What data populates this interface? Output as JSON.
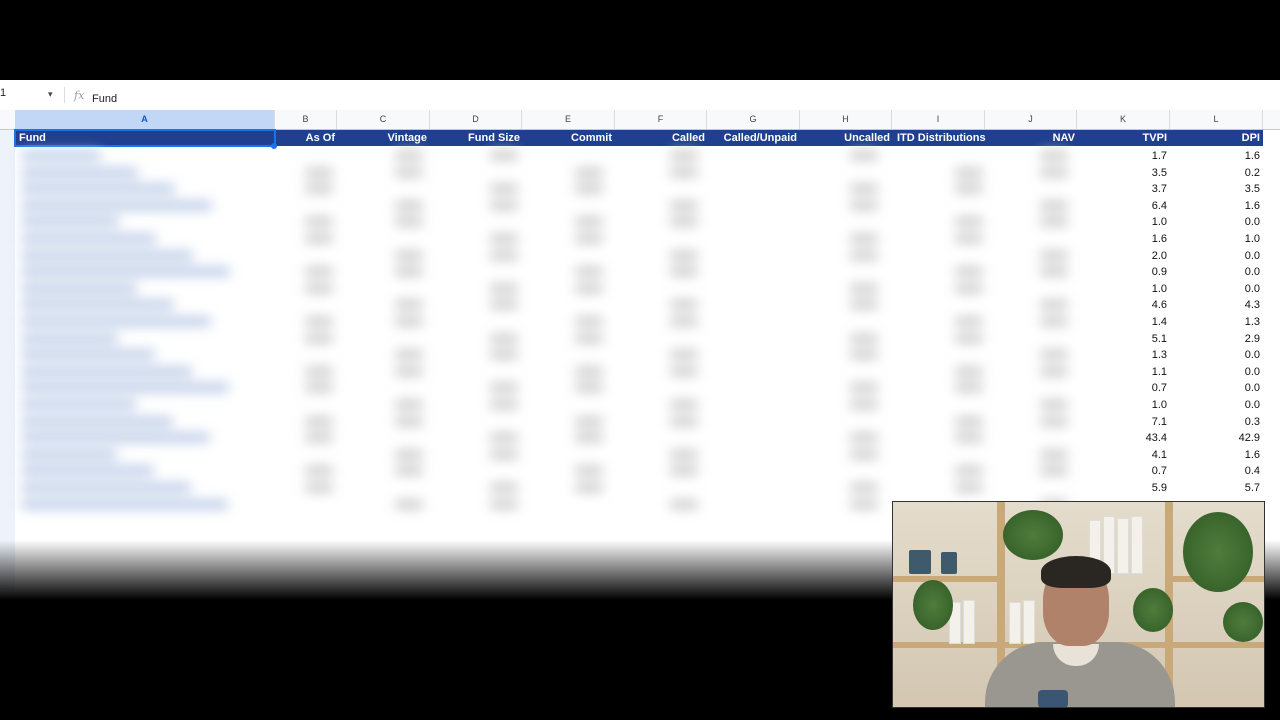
{
  "formula_bar": {
    "name_box": "1",
    "fx": "fx",
    "content": "Fund"
  },
  "column_letters": [
    "A",
    "B",
    "C",
    "D",
    "E",
    "F",
    "G",
    "H",
    "I",
    "J",
    "K",
    "L"
  ],
  "headers": {
    "fund": "Fund",
    "as_of": "As Of",
    "vintage": "Vintage",
    "fund_size": "Fund Size",
    "commit": "Commit",
    "called": "Called",
    "called_unpaid": "Called/Unpaid",
    "uncalled": "Uncalled",
    "itd_distributions": "ITD Distributions",
    "nav": "NAV",
    "tvpi": "TVPI",
    "dpi": "DPI"
  },
  "tvpi": [
    "1.7",
    "3.5",
    "3.7",
    "6.4",
    "1.0",
    "1.6",
    "2.0",
    "0.9",
    "1.0",
    "4.6",
    "1.4",
    "5.1",
    "1.3",
    "1.1",
    "0.7",
    "1.0",
    "7.1",
    "43.4",
    "4.1",
    "0.7",
    "5.9"
  ],
  "dpi": [
    "1.6",
    "0.2",
    "3.5",
    "1.6",
    "0.0",
    "1.0",
    "0.0",
    "0.0",
    "0.0",
    "4.3",
    "1.3",
    "2.9",
    "0.0",
    "0.0",
    "0.0",
    "0.0",
    "0.3",
    "42.9",
    "1.6",
    "0.4",
    "5.7"
  ],
  "colors": {
    "header_bg": "#1f3f8f",
    "header_text": "#ffffff",
    "selection": "#1a73e8"
  }
}
